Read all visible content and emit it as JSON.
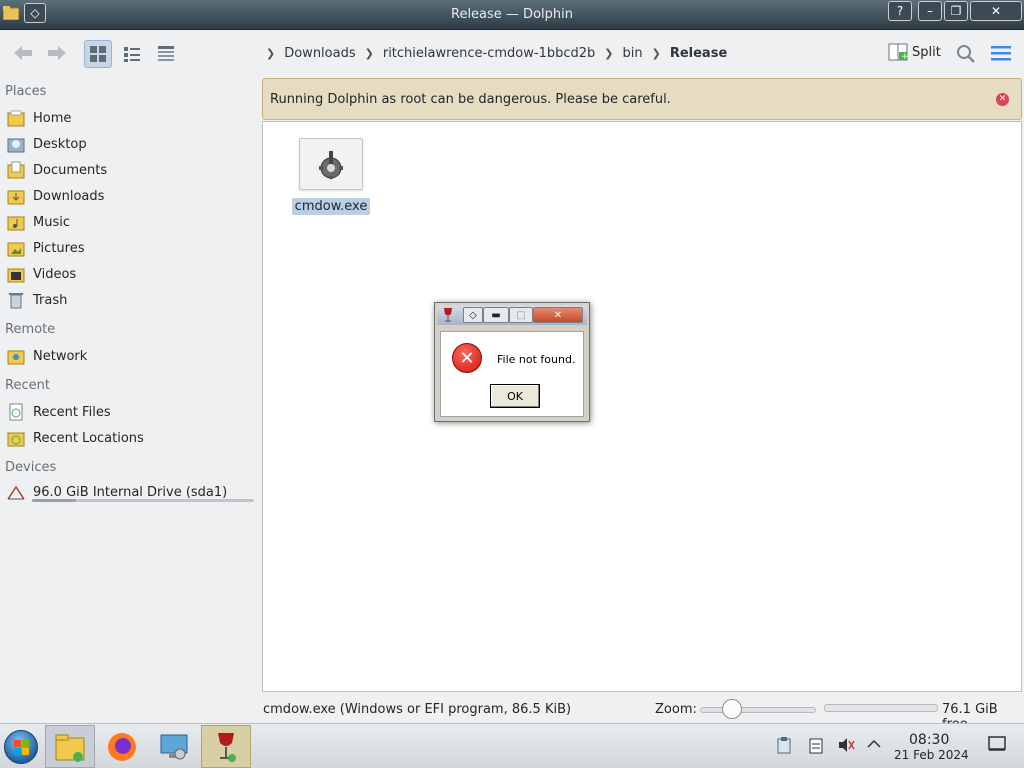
{
  "window": {
    "title": "Release — Dolphin",
    "help_label": "?",
    "min_label": "–",
    "max_label": "❐",
    "close_label": "✕"
  },
  "toolbar": {
    "split_label": "Split"
  },
  "breadcrumb": [
    "Downloads",
    "ritchielawrence-cmdow-1bbcd2b",
    "bin",
    "Release"
  ],
  "sidebar": {
    "places_title": "Places",
    "places": [
      "Home",
      "Desktop",
      "Documents",
      "Downloads",
      "Music",
      "Pictures",
      "Videos",
      "Trash"
    ],
    "remote_title": "Remote",
    "remote": [
      "Network"
    ],
    "recent_title": "Recent",
    "recent": [
      "Recent Files",
      "Recent Locations"
    ],
    "devices_title": "Devices",
    "devices": [
      "96.0 GiB Internal Drive (sda1)"
    ],
    "drive_usage": 0.2
  },
  "notification": {
    "message": "Running Dolphin as root can be dangerous. Please be careful."
  },
  "files": [
    {
      "name": "cmdow.exe"
    }
  ],
  "dialog": {
    "message": "File not found.",
    "ok_label": "OK",
    "close_label": "✕"
  },
  "statusbar": {
    "selection": "cmdow.exe (Windows or EFI program, 86.5 KiB)",
    "zoom_label": "Zoom:",
    "free_space": "76.1 GiB free"
  },
  "taskbar": {
    "time": "08:30",
    "date": "21 Feb 2024"
  },
  "colors": {
    "accent": "#3daee9",
    "notify_bg": "#e5dcc1",
    "selection": "#b9cfe4",
    "error": "#da4453"
  }
}
